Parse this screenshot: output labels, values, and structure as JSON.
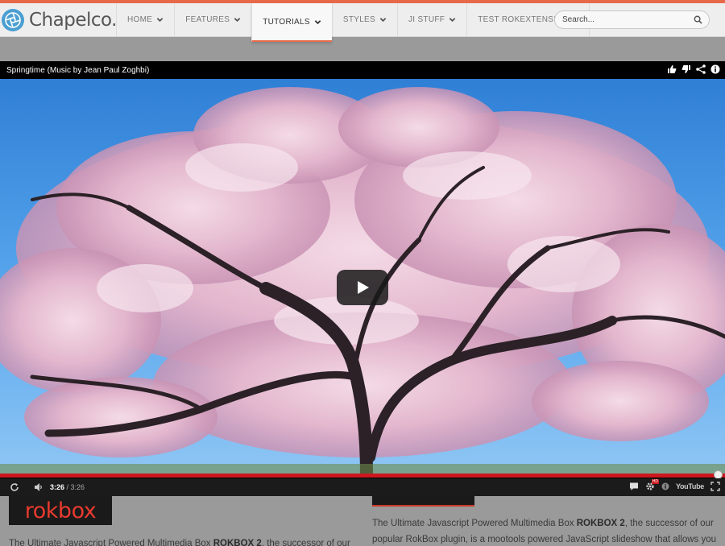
{
  "site": {
    "logo_text": "Chapelco.",
    "logo_icon": "aperture-icon",
    "accent_color": "#e8694a",
    "nav": [
      {
        "label": "HOME",
        "active": false
      },
      {
        "label": "FEATURES",
        "active": false
      },
      {
        "label": "TUTORIALS",
        "active": true
      },
      {
        "label": "STYLES",
        "active": false
      },
      {
        "label": "JI STUFF",
        "active": false
      },
      {
        "label": "TEST ROKEXTENSIES",
        "active": false
      }
    ],
    "search": {
      "placeholder": "Search..."
    }
  },
  "video": {
    "title": "Springtime (Music by Jean Paul Zoghbi)",
    "actions": [
      "like-icon",
      "dislike-icon",
      "share-icon",
      "info-icon"
    ],
    "current_time": "3:26",
    "separator": " / ",
    "duration": "3:26",
    "progress": 1.0,
    "progress_color": "#cc181e",
    "youtube_label": "YouTube",
    "hd_badge": "HD",
    "controls": [
      "replay-icon",
      "volume-icon",
      "captions-icon",
      "settings-icon",
      "annotations-icon",
      "youtube-logo",
      "fullscreen-icon"
    ]
  },
  "content": {
    "rokbox_logo": "rokbox",
    "left_para": {
      "before": "The Ultimate Javascript Powered Multimedia Box ",
      "bold": "ROKBOX 2",
      "after": ", the successor of our"
    },
    "right_para": {
      "before": "The Ultimate Javascript Powered Multimedia Box ",
      "bold": "ROKBOX 2",
      "after": ", the successor of our popular RokBox plugin, is a mootools powered JavaScript slideshow that allows you to"
    }
  }
}
